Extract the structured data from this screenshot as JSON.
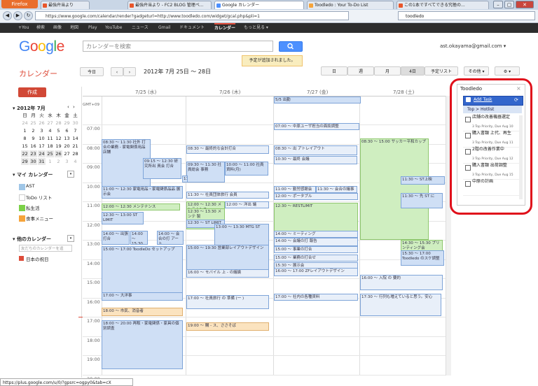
{
  "browser": {
    "menu_button": "Firefox",
    "tabs": [
      {
        "label": "最強弁当より"
      },
      {
        "label": "最強弁当より - FC2 BLOG 管理ペ..."
      },
      {
        "label": "Google カレンダー"
      },
      {
        "label": "Toodledo : Your To-Do List"
      },
      {
        "label": "この1本ですべてできる究極の..."
      }
    ],
    "url": "https://www.google.com/calendar/render?gadgeturl=http://www.toodledo.com/widget/gcal.php&pli=1",
    "search_value": "toodledo",
    "status_url": "https://plus.google.com/u/0/?gpsrc=ogpy0&tab=cX"
  },
  "google_bar": {
    "items": [
      "+You",
      "検索",
      "画像",
      "地図",
      "Play",
      "YouTube",
      "ニュース",
      "Gmail",
      "ドキュメント",
      "カレンダー",
      "もっと見る ▾"
    ],
    "active_index": 9
  },
  "header": {
    "logo": "Google",
    "search_placeholder": "カレンダーを検索",
    "account": "ast.okayama@gmail.com ▾",
    "notice": "予定が追加されました。"
  },
  "toolbar": {
    "app_title": "カレンダー",
    "today": "今日",
    "prev": "‹",
    "next": "›",
    "date_range": "2012年 7月 25日 ～ 28日",
    "views": [
      "日",
      "週",
      "月",
      "4日",
      "予定リスト"
    ],
    "active_view_index": 3,
    "more": "その他 ▾",
    "settings": "⚙ ▾"
  },
  "sidebar": {
    "create": "作成",
    "mini_cal_title": "2012年 7月",
    "weekdays": [
      "日",
      "月",
      "火",
      "水",
      "木",
      "金",
      "土"
    ],
    "weeks": [
      [
        "24",
        "25",
        "26",
        "27",
        "28",
        "29",
        "30"
      ],
      [
        "1",
        "2",
        "3",
        "4",
        "5",
        "6",
        "7"
      ],
      [
        "8",
        "9",
        "10",
        "11",
        "12",
        "13",
        "14"
      ],
      [
        "15",
        "16",
        "17",
        "18",
        "19",
        "20",
        "21"
      ],
      [
        "22",
        "23",
        "24",
        "25",
        "26",
        "27",
        "28"
      ],
      [
        "29",
        "30",
        "31",
        "1",
        "2",
        "3",
        "4"
      ]
    ],
    "my_calendars_title": "マイ カレンダー",
    "my_calendars": [
      {
        "name": "AST",
        "color": "#9fc6e7"
      },
      {
        "name": "ToDo リスト",
        "color": "#ffffff"
      },
      {
        "name": "私生活",
        "color": "#7bd148"
      },
      {
        "name": "食事メニュー",
        "color": "#f6a43b"
      }
    ],
    "other_calendars_title": "他のカレンダー",
    "other_placeholder": "友だちのカレンダーを追",
    "other_calendars": [
      {
        "name": "日本の祝日",
        "color": "#dd4b39"
      }
    ]
  },
  "grid": {
    "tz": "GMT+09",
    "days": [
      "7/25 (水)",
      "7/26 (木)",
      "7/27 (金)",
      "7/28 (土)"
    ],
    "times": [
      "07:00",
      "08:00",
      "09:00",
      "10:00",
      "11:00",
      "12:00",
      "13:00",
      "14:00",
      "15:00",
      "16:00",
      "17:00",
      "18:00",
      "19:00",
      "20:00"
    ],
    "events": [
      {
        "text": "5/5 出勤",
        "cls": "b"
      },
      {
        "text": "07:00 ～ 中原ユーザ担当の面談調整",
        "cls": "lb"
      },
      {
        "text": "08:30 ～ 11:30 社外 打合の業務 - 家電関係用品 店舗",
        "cls": "b"
      },
      {
        "text": "08:30 ～ 最終的な会計打合",
        "cls": "lb"
      },
      {
        "text": "08:30 ～ 出 アトレイアウト",
        "cls": "lb"
      },
      {
        "text": "08:30 ～ 15:00 サッカー平和カップ",
        "cls": "g"
      },
      {
        "text": "09:15 ～ 12:30 研究所出 員会 打合",
        "cls": "b"
      },
      {
        "text": "09:30 ～ 11:30 社員総会 事務",
        "cls": "b"
      },
      {
        "text": "11:30 ～ 12:00 新製品 会議",
        "cls": "b"
      },
      {
        "text": "10:00 ～ 11:00 社員資料(月)",
        "cls": "b"
      },
      {
        "text": "10:30 ～ 最終 会議",
        "cls": "lb"
      },
      {
        "text": "11:00 ～ 12:30 家電用品・家電関係品品 展示会",
        "cls": "b"
      },
      {
        "text": "11:30 ～ 社員団体旅行 会員",
        "cls": "lb"
      },
      {
        "text": "11:00 ～ 勤労感謝会",
        "cls": "lb"
      },
      {
        "text": "11:30 ～ 会合の議事",
        "cls": "lb"
      },
      {
        "text": "11:30 ～ ST上映",
        "cls": "b"
      },
      {
        "text": "11:30 ～ 先 ST に",
        "cls": "b"
      },
      {
        "text": "12:00 ～ 12:30 メンテナンス",
        "cls": "g"
      },
      {
        "text": "12:00 ～ 12:30 メンテナンス",
        "cls": "g"
      },
      {
        "text": "12:00 ～ 洋出 議",
        "cls": "lb"
      },
      {
        "text": "12:00 ～ ポータブル",
        "cls": "lb"
      },
      {
        "text": "12:30 ～ 13:30 メンテ 製",
        "cls": "g"
      },
      {
        "text": "12:30 ～ 13:00 ST LIMIT",
        "cls": "b"
      },
      {
        "text": "12:30 ～ ST LIMIT",
        "cls": "b"
      },
      {
        "text": "12:30 ～ RESTLIMIT",
        "cls": "g"
      },
      {
        "text": "13:00 ～ 13:30 MTG ST",
        "cls": "b"
      },
      {
        "text": "14:00 ～ 出張 打合",
        "cls": "b"
      },
      {
        "text": "14:00 ～ 15:30 打ち 打合せ",
        "cls": "b"
      },
      {
        "text": "14:00 ～ 会合の打 アート",
        "cls": "b"
      },
      {
        "text": "14:00 ～ ミーティング",
        "cls": "lb"
      },
      {
        "text": "14:30 ～ 15:30 プリンティング会",
        "cls": "g"
      },
      {
        "text": "14:00 ～ 会議の打 報告",
        "cls": "lb"
      },
      {
        "text": "15:00 ～ 17:00 ToodleDo セットアップ",
        "cls": "b"
      },
      {
        "text": "15:00 ～ 19:30 営業部レイアウトデザイン",
        "cls": "b"
      },
      {
        "text": "15:00 ～ 事業の打合",
        "cls": "lb"
      },
      {
        "text": "15:00 ～ 業務の打合せ",
        "cls": "lb"
      },
      {
        "text": "15:30 ～ 展示会",
        "cls": "lb"
      },
      {
        "text": "15:30 ～ 17:00 Toodledo のスケ調整",
        "cls": "b"
      },
      {
        "text": "16:00 ～ モバイル 上 - の議論",
        "cls": "lb"
      },
      {
        "text": "16:00 ～ 17:00 ZFレイアウトデザイン",
        "cls": "lb"
      },
      {
        "text": "16:00 ～ 入院 の 要約",
        "cls": "lb"
      },
      {
        "text": "17:00 ～ 大洋事",
        "cls": "b"
      },
      {
        "text": "17:00 ～ 社員旅行 の 準備 (一 )",
        "cls": "lb"
      },
      {
        "text": "17:00 ～ 社内の各種資料",
        "cls": "lb"
      },
      {
        "text": "18:00 ～ 市民、消音者",
        "cls": "o"
      },
      {
        "text": "18:00 ～ 20:00 再販・家電関係・家具の個別調査",
        "cls": "b"
      },
      {
        "text": "19:00 ～ 購 - ス、ささそば",
        "cls": "o"
      },
      {
        "text": "17:30 ～ 行列も増えていると思う。安心",
        "cls": "lb"
      }
    ]
  },
  "gadget": {
    "title": "Toodledo",
    "close": "×",
    "add_task": "Add Task",
    "nav": "Top > Hotlist",
    "tasks": [
      {
        "title": "店舗の改善機器選定",
        "sub": "3 Top Priority, Due Aug 10"
      },
      {
        "title": "購入書類 上代、再生",
        "sub": "3 Top Priority, Due Aug 11"
      },
      {
        "title": "2階の改善作業中",
        "sub": "3 Top Priority, Due Aug 12"
      },
      {
        "title": "購入書類 出荷調整",
        "sub": "3 Top Priority, Due Aug 15"
      },
      {
        "title": "中原の計画",
        "sub": ""
      }
    ]
  },
  "colors": {
    "accent_red": "#dd4b39",
    "google_blue": "#4d90fe",
    "annotation_ring": "#e0101b"
  }
}
